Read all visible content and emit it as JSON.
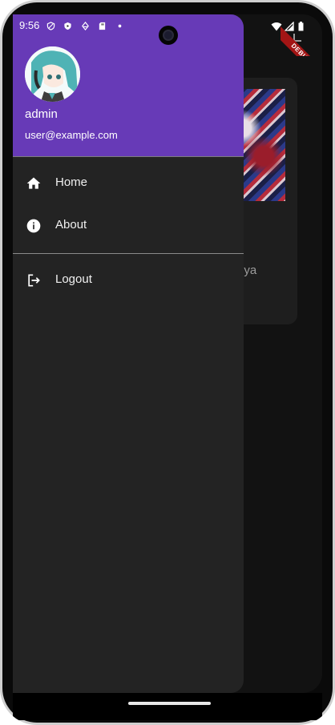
{
  "status_bar": {
    "time": "9:56",
    "left_icons": [
      "shield-icon",
      "play-protect-icon",
      "vpn-icon",
      "sd-card-icon",
      "dot-icon"
    ],
    "right_icons": [
      "wifi-icon",
      "signal-icon",
      "battery-icon"
    ]
  },
  "debug_banner": {
    "label": "DEBUG",
    "color": "#a31515"
  },
  "background_app": {
    "add_button_icon": "plus-icon",
    "card_text": "ng\narganya\ntan"
  },
  "drawer": {
    "header": {
      "background_color": "#673ab7",
      "account_name": "admin",
      "account_email": "user@example.com"
    },
    "items": [
      {
        "label": "Home",
        "icon": "home-icon"
      },
      {
        "label": "About",
        "icon": "info-icon"
      }
    ],
    "secondary_items": [
      {
        "label": "Logout",
        "icon": "logout-icon"
      }
    ]
  }
}
